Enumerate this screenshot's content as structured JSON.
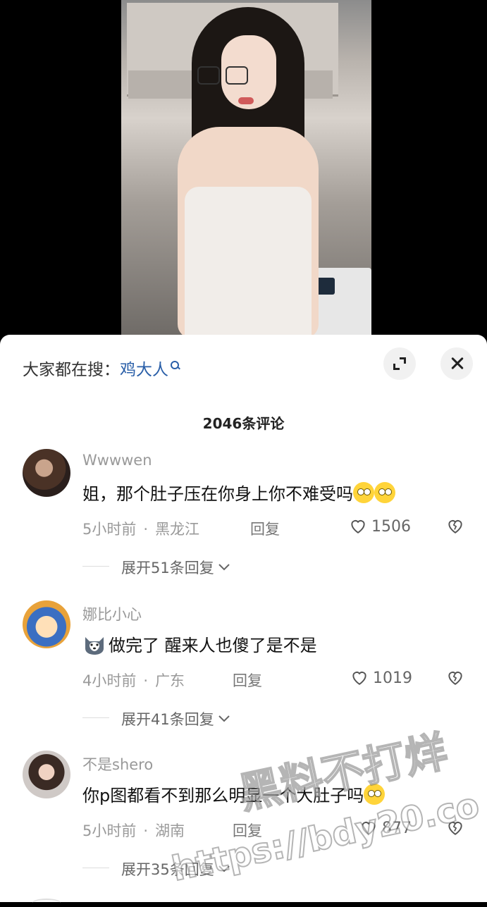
{
  "search_bar": {
    "label": "大家都在搜：",
    "keyword": "鸡大人"
  },
  "comment_count": "2046条评论",
  "comments": [
    {
      "username": "Wwwwen",
      "text": "姐，那个肚子压在你身上你不难受吗",
      "time": "5小时前",
      "location": "黑龙江",
      "reply": "回复",
      "likes": "1506",
      "expand": "展开51条回复"
    },
    {
      "username": "娜比小心",
      "text": "做完了 醒来人也傻了是不是",
      "time": "4小时前",
      "location": "广东",
      "reply": "回复",
      "likes": "1019",
      "expand": "展开41条回复"
    },
    {
      "username": "不是shero",
      "text": "你p图都看不到那么明显一个大肚子吗",
      "time": "5小时前",
      "location": "湖南",
      "reply": "回复",
      "likes": "877",
      "expand": "展开35条回复"
    }
  ],
  "separator": "·",
  "watermark": {
    "line1": "黑料不打烊",
    "line2": "https://bdy20.co"
  },
  "icons": {
    "search": "search-icon",
    "expand": "expand-icon",
    "close": "close-icon",
    "like": "heart-icon",
    "dislike": "broken-heart-icon",
    "chevron": "chevron-down-icon"
  }
}
